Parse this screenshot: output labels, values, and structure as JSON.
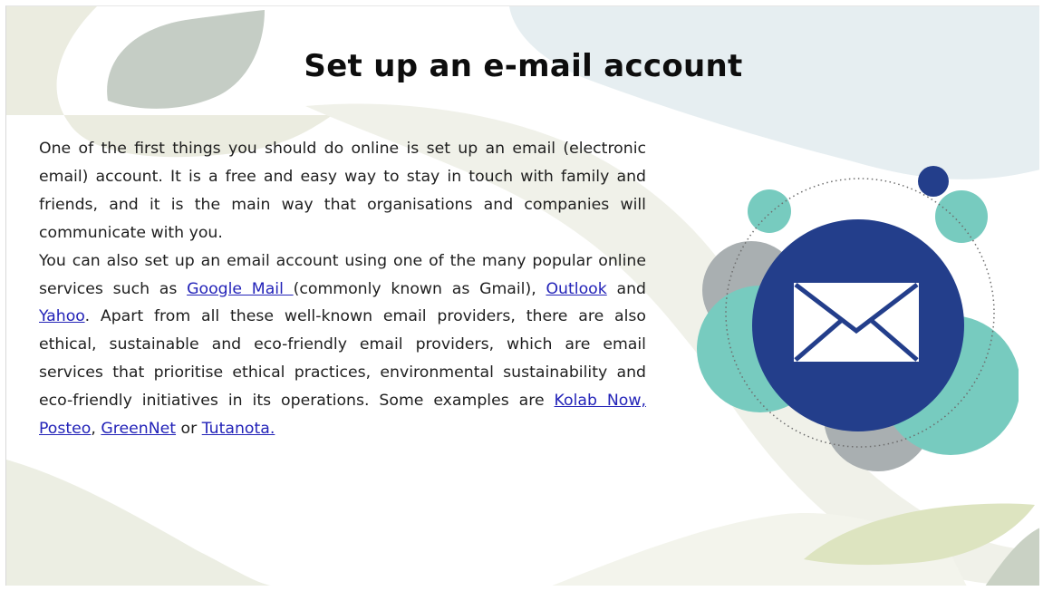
{
  "slide": {
    "title": "Set up an e-mail account",
    "paragraph1": "One of the first things you should do online is set up an email (electronic email) account. It is a free and easy way to stay in touch with family and friends, and it is the main way that organisations and companies will communicate with you.",
    "paragraph2": {
      "text1": "You can also set up an email account using one of the many popular online services such as ",
      "link_google": "Google Mail ",
      "text2": "(commonly known as Gmail), ",
      "link_outlook": "Outlook",
      "text3": " and ",
      "link_yahoo": "Yahoo",
      "text4": ". Apart from all these well-known email providers, there are also ethical, sustainable and eco-friendly email providers, which are email services that prioritise ethical practices, environmental sustainability and eco-friendly initiatives in its operations. Some examples are ",
      "link_kolab": "Kolab Now,",
      "link_posteo": "Posteo",
      "text5": ", ",
      "link_greennet": "GreenNet",
      "text6": " or ",
      "link_tutanota": "Tutanota."
    }
  },
  "illustration": {
    "icon": "envelope-icon"
  },
  "colors": {
    "navy": "#233e8b",
    "teal": "#77cbbf",
    "grey": "#a9afb1",
    "link": "#2323b8",
    "leaf_sage": "#c5cdc5",
    "bg_blue": "#e6eef1",
    "bg_beige": "#ebece0",
    "leaf_olive": "#dde4c0"
  }
}
